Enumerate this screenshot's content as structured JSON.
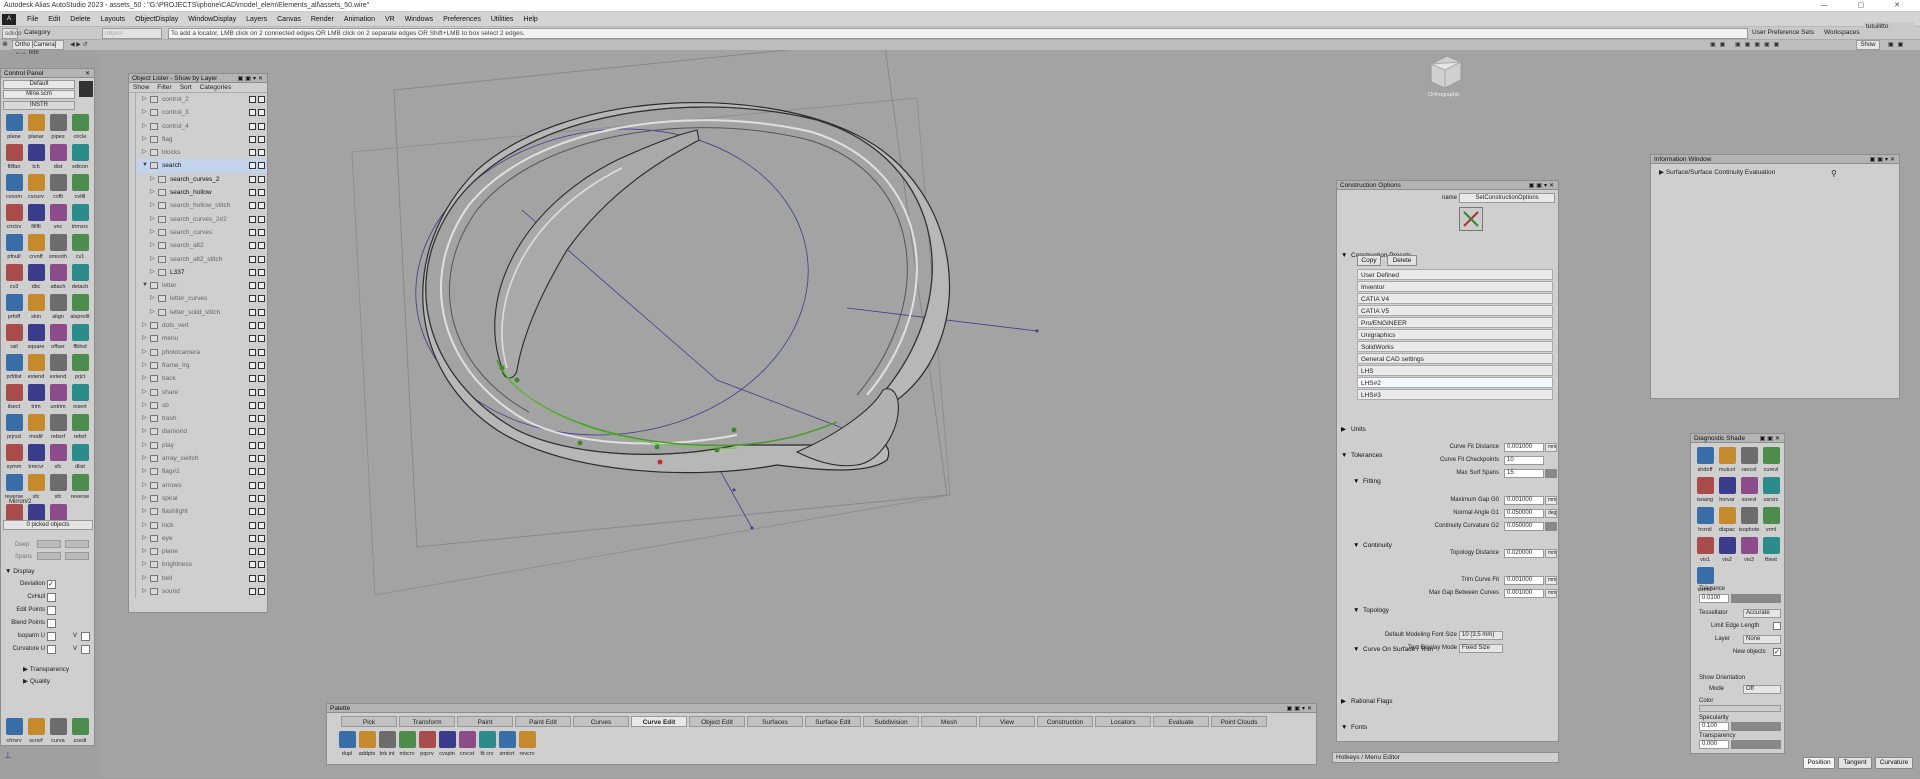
{
  "title": "Autodesk Alias AutoStudio 2023   - assets_50 : \"G:\\PROJECTS\\iphone\\CAD\\model_elem\\Elements_all\\assets_50.wire\"",
  "menu": [
    "File",
    "Edit",
    "Delete",
    "Layouts",
    "ObjectDisplay",
    "WindowDisplay",
    "Layers",
    "Canvas",
    "Render",
    "Animation",
    "VR",
    "Windows",
    "Preferences",
    "Utilities",
    "Help"
  ],
  "toolbar": {
    "field1": "sdiicon",
    "category": "Category",
    "object": "object",
    "prompt": "To add a locator, LMB click on 2 connected edges OR LMB click on 2 separate edges OR Shift+LMB to box select 2 edges.",
    "user_prefs": "User Preference Sets",
    "workspaces": "Workspaces",
    "user": "tutuilitto",
    "show": "Show"
  },
  "view_label": "Ortho [Camera] ↔↔ mm",
  "control_panel": {
    "title": "Control Panel",
    "preset": "Default",
    "file": "Mine.scm",
    "shelf": "INSTR",
    "tools": [
      "plane",
      "planar",
      "pipes",
      "circle",
      "fillfan",
      "tch",
      "dist",
      "sdicon",
      "cvcom",
      "cvcurv",
      "cvflt",
      "cvfill",
      "circtrv",
      "fillflt",
      "vec",
      "trimsrc",
      "pfnull",
      "crvoff",
      "smooth",
      "cv1",
      "cv3",
      "dbc",
      "attach",
      "detach",
      "prfoff",
      "skin",
      "align",
      "alsprofit",
      "rail",
      "square",
      "offser",
      "ffblnd",
      "prfdist",
      "extend",
      "extend",
      "prjct",
      "ilsect",
      "trim",
      "untrim",
      "insert",
      "prjrsd",
      "modif",
      "rebsrf",
      "refsrf",
      "symm",
      "trmcvr",
      "sfc",
      "dlist",
      "reverse",
      "sfc",
      "sfc",
      "reverse",
      "revsr",
      "unifor",
      "place"
    ],
    "mirror": "Mirror#2",
    "picked": "0 picked objects",
    "deep": "Deep",
    "spans": "Spans",
    "display_title": "Display",
    "display_items": [
      "Deviation",
      "CvHull",
      "Edit Points",
      "Blend Points",
      "Isoparm U",
      "Curvature U"
    ],
    "vlabel": "V",
    "transparency": "Transparency",
    "quality": "Quality",
    "bottom_tools": [
      "cfrrsrv",
      "scrsrf",
      "curva",
      "zzedt"
    ]
  },
  "object_lister": {
    "title": "Object Lister - Show by Layer",
    "menu": [
      "Show",
      "Filter",
      "Sort",
      "Categories"
    ],
    "rows": [
      {
        "name": "control_2",
        "lvl": 0
      },
      {
        "name": "control_3",
        "lvl": 0
      },
      {
        "name": "control_4",
        "lvl": 0
      },
      {
        "name": "flag",
        "lvl": 0
      },
      {
        "name": "blocks",
        "lvl": 0
      },
      {
        "name": "search",
        "lvl": 0,
        "sel": true,
        "open": true
      },
      {
        "name": "search_curves_2",
        "lvl": 1,
        "dark": true
      },
      {
        "name": "search_hollow",
        "lvl": 1,
        "dark": true
      },
      {
        "name": "search_hollow_stitch",
        "lvl": 1
      },
      {
        "name": "search_curves_2#2",
        "lvl": 1
      },
      {
        "name": "search_curves",
        "lvl": 1
      },
      {
        "name": "search_alt2",
        "lvl": 1
      },
      {
        "name": "search_alt2_stitch",
        "lvl": 1
      },
      {
        "name": "L337",
        "lvl": 1,
        "dark": true
      },
      {
        "name": "letter",
        "lvl": 0,
        "open": true
      },
      {
        "name": "letter_curves",
        "lvl": 1
      },
      {
        "name": "letter_solid_stitch",
        "lvl": 1
      },
      {
        "name": "dots_vert",
        "lvl": 0
      },
      {
        "name": "menu",
        "lvl": 0
      },
      {
        "name": "photocamera",
        "lvl": 0
      },
      {
        "name": "frame_lrg",
        "lvl": 0
      },
      {
        "name": "back",
        "lvl": 0
      },
      {
        "name": "share",
        "lvl": 0
      },
      {
        "name": "sb",
        "lvl": 0
      },
      {
        "name": "trash",
        "lvl": 0
      },
      {
        "name": "diamond",
        "lvl": 0
      },
      {
        "name": "play",
        "lvl": 0
      },
      {
        "name": "array_switch",
        "lvl": 0
      },
      {
        "name": "flag#2",
        "lvl": 0
      },
      {
        "name": "arrows",
        "lvl": 0
      },
      {
        "name": "spiral",
        "lvl": 0
      },
      {
        "name": "flashlight",
        "lvl": 0
      },
      {
        "name": "lock",
        "lvl": 0
      },
      {
        "name": "eye",
        "lvl": 0
      },
      {
        "name": "plane",
        "lvl": 0
      },
      {
        "name": "brightness",
        "lvl": 0
      },
      {
        "name": "bell",
        "lvl": 0
      },
      {
        "name": "sound",
        "lvl": 0
      }
    ]
  },
  "construction": {
    "title": "Construction Options",
    "name_label": "name",
    "name_value": "SetConstructionOptions",
    "presets_title": "Construction Presets",
    "copy": "Copy",
    "delete": "Delete",
    "presets": [
      "User Defined",
      "Inventor",
      "CATIA V4",
      "CATIA V5",
      "Pro/ENGINEER",
      "Unigraphics",
      "SolidWorks",
      "General CAD settings",
      "LHS",
      "LHS#2",
      "LHS#3"
    ],
    "units": "Units",
    "tolerances": "Tolerances",
    "fitting": "Fitting",
    "curve_fit_distance": {
      "label": "Curve Fit Distance",
      "value": "0.001000",
      "unit": "mm"
    },
    "curve_fit_checkpoints": {
      "label": "Curve Fit Checkpoints",
      "value": "10"
    },
    "max_surf_spans": {
      "label": "Max Surf Spans",
      "value": "15"
    },
    "continuity": "Continuity",
    "max_gap": {
      "label": "Maximum Gap G0",
      "value": "0.001000",
      "unit": "mm"
    },
    "normal_angle": {
      "label": "Normal Angle G1",
      "value": "0.050000",
      "unit": "deg"
    },
    "continuity_curv": {
      "label": "Continuity Curvature G2",
      "value": "0.050000"
    },
    "topology": "Topology",
    "topology_distance": {
      "label": "Topology Distance",
      "value": "0.020000",
      "unit": "mm"
    },
    "cos_trim": "Curve On Surface / Trim",
    "trim_curve_fit": {
      "label": "Trim Curve Fit",
      "value": "0.001000",
      "unit": "mm"
    },
    "max_gap_curves": {
      "label": "Max Gap Between Curves",
      "value": "0.001000",
      "unit": "mm"
    },
    "rational": "Rational Flags",
    "fonts": "Fonts",
    "font_size": {
      "label": "Default Modeling Font Size",
      "value": "10 (3.5 mm)"
    },
    "text_mode": {
      "label": "Text Display Mode",
      "value": "Fixed Size"
    },
    "hotkeys": "Hotkeys / Menu Editor"
  },
  "info_window": {
    "title": "Information Window",
    "item": "Surface/Surface Continuity Evaluation"
  },
  "diag_shade": {
    "title": "Diagnostic Shade",
    "tools": [
      "shdoff",
      "muicol",
      "rancol",
      "curevl",
      "isoang",
      "horvar",
      "surevl",
      "usrsrc",
      "hrzntl",
      "dispac",
      "isophote",
      "vrml",
      "vis1",
      "vis2",
      "vis3",
      "fbest",
      "tsrmul"
    ],
    "tolerance_label": "Tolerance",
    "tolerance": "0.0100",
    "tessellator_label": "Tessellator",
    "tessellator": "Accurate",
    "limit_edge": "Limit Edge Length",
    "layer_label": "Layer",
    "layer": "None",
    "new_objects": "New objects",
    "show_orient": "Show Orientation",
    "mode_label": "Mode",
    "mode": "Off",
    "color": "Color",
    "specularity_label": "Specularity",
    "specularity": "0.100",
    "transparency_label": "Transparency",
    "transparency": "0.000"
  },
  "palette": {
    "title": "Palette",
    "tabs": [
      "Pick",
      "Transform",
      "Paint",
      "Paint Edit",
      "Curves",
      "Curve Edit",
      "Object Edit",
      "Surfaces",
      "Surface Edit",
      "Subdivision",
      "Mesh",
      "View",
      "Construction",
      "Locators",
      "Evaluate",
      "Point Clouds"
    ],
    "active": "Curve Edit",
    "tools": [
      "dupl",
      "addpts",
      "brk int",
      "mbcrv",
      "pqcrv",
      "cvspin",
      "crvcst",
      "fit crv",
      "smtcrt",
      "revcrv"
    ]
  },
  "statusbar": {
    "position": "Position",
    "tangent": "Tangent",
    "curvature": "Curvature"
  },
  "viewcube": "Orthographic"
}
